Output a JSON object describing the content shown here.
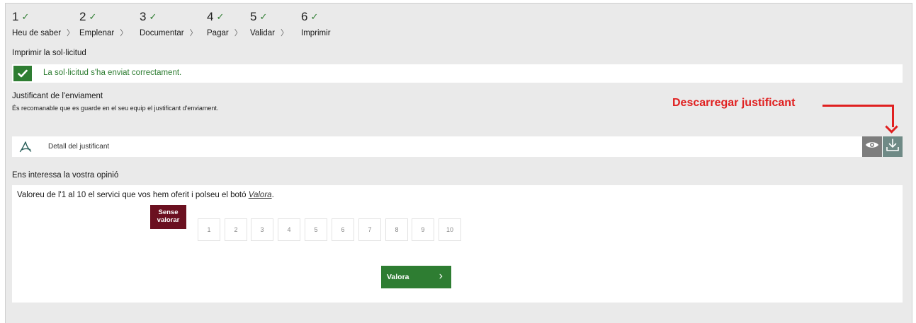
{
  "steps": [
    {
      "number": "1",
      "label": "Heu de saber",
      "check": "✓",
      "sep": "〉"
    },
    {
      "number": "2",
      "label": "Emplenar",
      "check": "✓",
      "sep": "〉"
    },
    {
      "number": "3",
      "label": "Documentar",
      "check": "✓",
      "sep": "〉"
    },
    {
      "number": "4",
      "label": "Pagar",
      "check": "✓",
      "sep": "〉"
    },
    {
      "number": "5",
      "label": "Validar",
      "check": "✓",
      "sep": "〉"
    },
    {
      "number": "6",
      "label": "Imprimir",
      "check": "✓",
      "sep": ""
    }
  ],
  "page_title": "Imprimir la sol·licitud",
  "success": {
    "message": "La sol·licitud s'ha enviat correctament.",
    "icon": "check-icon",
    "color": "#2e7d32"
  },
  "receipt": {
    "title": "Justificant de l'enviament",
    "note": "És recomanable que es guarde en el seu equip el justificant d'enviament.",
    "document_label": "Detall del justificant",
    "icons": [
      "pdf-icon",
      "eye-icon",
      "download-icon"
    ]
  },
  "annotation": {
    "text": "Descarregar justificant",
    "color": "#e02020"
  },
  "opinion": {
    "title": "Ens interessa la vostra opinió",
    "prompt_before": "Valoreu de l'1 al 10 el servici que vos hem oferit i polseu el botó ",
    "prompt_link": "Valora",
    "prompt_after": ".",
    "no_rating_label": "Sense valorar",
    "options": [
      "1",
      "2",
      "3",
      "4",
      "5",
      "6",
      "7",
      "8",
      "9",
      "10"
    ],
    "submit_label": "Valora",
    "submit_arrow": "›",
    "accent_color": "#6b1020"
  }
}
